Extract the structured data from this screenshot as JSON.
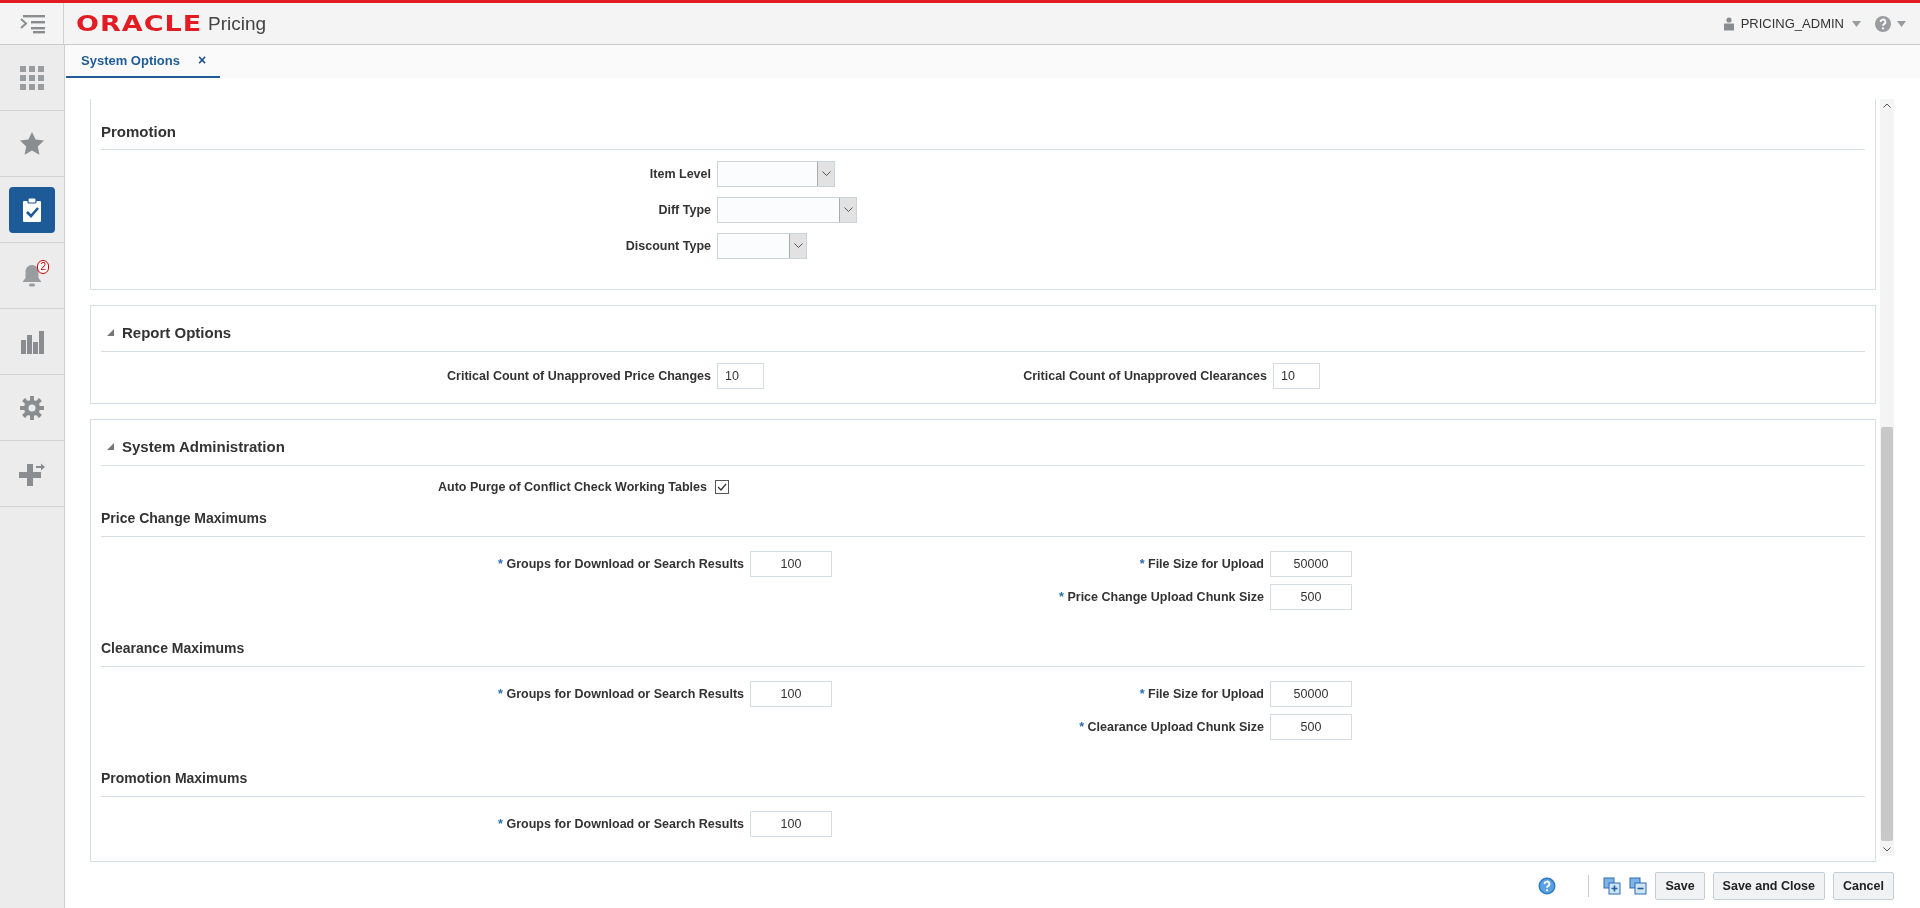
{
  "header": {
    "brand": "ORACLE",
    "product": "Pricing",
    "user": "PRICING_ADMIN"
  },
  "sidebar": [
    {
      "kind": "apps",
      "selected": false
    },
    {
      "kind": "favorites",
      "selected": false
    },
    {
      "kind": "tasks",
      "selected": true
    },
    {
      "kind": "notifications",
      "selected": false,
      "badge": "2"
    },
    {
      "kind": "reports",
      "selected": false
    },
    {
      "kind": "settings",
      "selected": false
    },
    {
      "kind": "add",
      "selected": false
    }
  ],
  "tabs": [
    {
      "label": "System Options",
      "selected": true,
      "close": "×"
    }
  ],
  "promotion": {
    "title": "Promotion",
    "fields": [
      {
        "label": "Item Level"
      },
      {
        "label": "Diff Type"
      },
      {
        "label": "Discount Type"
      }
    ]
  },
  "report_options": {
    "title": "Report Options",
    "expanded": true,
    "fields": [
      {
        "label": "Critical Count of Unapproved Price Changes",
        "value": "10"
      },
      {
        "label": "Critical Count of Unapproved Clearances",
        "value": "10"
      }
    ]
  },
  "system_administration": {
    "title": "System Administration",
    "expanded": true,
    "auto_purge": {
      "label": "Auto Purge of Conflict Check Working Tables",
      "checked": true
    },
    "groups": [
      {
        "title": "Price Change Maximums",
        "left": [
          {
            "mark": "*",
            "label": "Groups for Download or Search Results",
            "value": "100"
          }
        ],
        "right": [
          {
            "mark": "*",
            "label": "File Size for Upload",
            "value": "50000"
          },
          {
            "mark": "*",
            "label": "Price Change Upload Chunk Size",
            "value": "500"
          }
        ]
      },
      {
        "title": "Clearance Maximums",
        "left": [
          {
            "mark": "*",
            "label": "Groups for Download or Search Results",
            "value": "100"
          }
        ],
        "right": [
          {
            "mark": "*",
            "label": "File Size for Upload",
            "value": "50000"
          },
          {
            "mark": "*",
            "label": "Clearance Upload Chunk Size",
            "value": "500"
          }
        ]
      },
      {
        "title": "Promotion Maximums",
        "left": [
          {
            "mark": "*",
            "label": "Groups for Download or Search Results",
            "value": "100"
          }
        ]
      }
    ]
  },
  "footer": {
    "buttons": [
      "Save",
      "Save and Close",
      "Cancel"
    ]
  }
}
